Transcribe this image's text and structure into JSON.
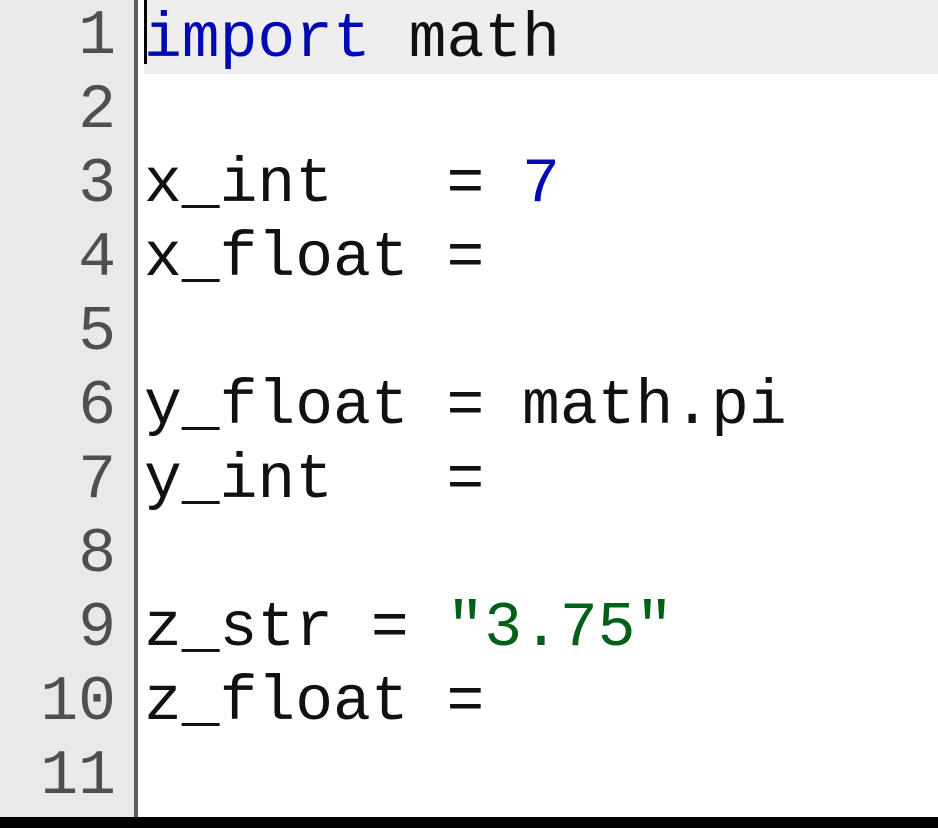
{
  "editor": {
    "gutter": [
      "1",
      "2",
      "3",
      "4",
      "5",
      "6",
      "7",
      "8",
      "9",
      "10",
      "11"
    ],
    "current_line_index": 0,
    "cursor_before_token_index": 0,
    "lines": [
      {
        "tokens": [
          {
            "t": "import",
            "c": "keyword"
          },
          {
            "t": " math",
            "c": "default"
          }
        ]
      },
      {
        "tokens": []
      },
      {
        "tokens": [
          {
            "t": "x_int   = ",
            "c": "default"
          },
          {
            "t": "7",
            "c": "number"
          }
        ]
      },
      {
        "tokens": [
          {
            "t": "x_float = ",
            "c": "default"
          }
        ]
      },
      {
        "tokens": []
      },
      {
        "tokens": [
          {
            "t": "y_float = math.pi",
            "c": "default"
          }
        ]
      },
      {
        "tokens": [
          {
            "t": "y_int   = ",
            "c": "default"
          }
        ]
      },
      {
        "tokens": []
      },
      {
        "tokens": [
          {
            "t": "z_str = ",
            "c": "default"
          },
          {
            "t": "\"3.75\"",
            "c": "string"
          }
        ]
      },
      {
        "tokens": [
          {
            "t": "z_float =",
            "c": "default"
          }
        ]
      },
      {
        "tokens": []
      }
    ]
  }
}
